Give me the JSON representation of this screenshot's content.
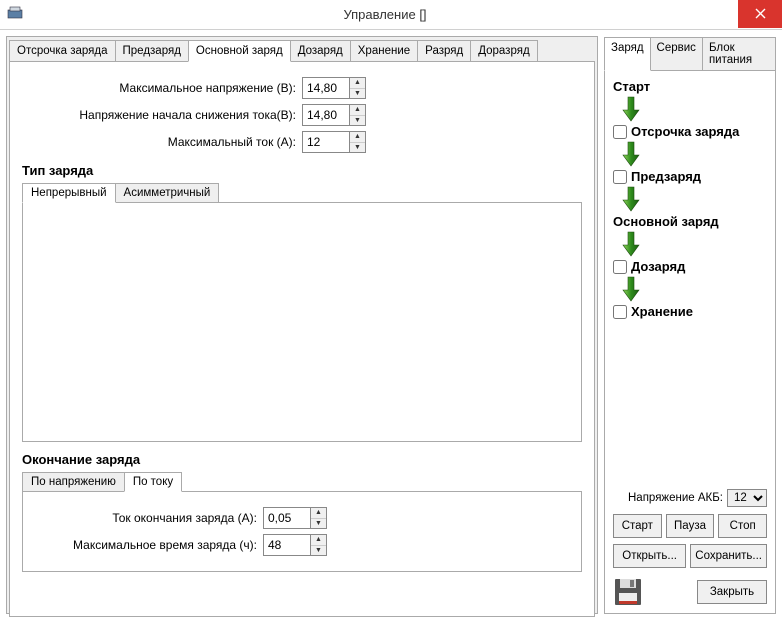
{
  "window": {
    "title": "Управление []"
  },
  "leftTabs": [
    "Отсрочка заряда",
    "Предзаряд",
    "Основной заряд",
    "Дозаряд",
    "Хранение",
    "Разряд",
    "Доразряд"
  ],
  "leftActiveIndex": 2,
  "fields": {
    "maxVoltage": {
      "label": "Максимальное напряжение (В):",
      "value": "14,80"
    },
    "startCurrentDropVoltage": {
      "label": "Напряжение начала снижения тока(В):",
      "value": "14,80"
    },
    "maxCurrent": {
      "label": "Максимальный ток (А):",
      "value": "12"
    }
  },
  "chargeTypeHeading": "Тип заряда",
  "chargeTypeTabs": [
    "Непрерывный",
    "Асимметричный"
  ],
  "endHeading": "Окончание заряда",
  "endTabs": [
    "По напряжению",
    "По току"
  ],
  "endActiveIndex": 1,
  "endFields": {
    "endCurrent": {
      "label": "Ток окончания заряда (А):",
      "value": "0,05"
    },
    "maxTime": {
      "label": "Максимальное время заряда (ч):",
      "value": "48"
    }
  },
  "rightTabs": [
    "Заряд",
    "Сервис",
    "Блок питания"
  ],
  "flow": {
    "start": "Старт",
    "steps": [
      {
        "label": "Отсрочка заряда",
        "checked": false
      },
      {
        "label": "Предзаряд",
        "checked": false
      },
      {
        "label": "Основной заряд",
        "plain": true
      },
      {
        "label": "Дозаряд",
        "checked": false
      },
      {
        "label": "Хранение",
        "checked": false
      }
    ]
  },
  "akb": {
    "label": "Напряжение АКБ:",
    "value": "12"
  },
  "buttons": {
    "start": "Старт",
    "pause": "Пауза",
    "stop": "Стоп",
    "open": "Открыть...",
    "save": "Сохранить...",
    "close": "Закрыть"
  }
}
